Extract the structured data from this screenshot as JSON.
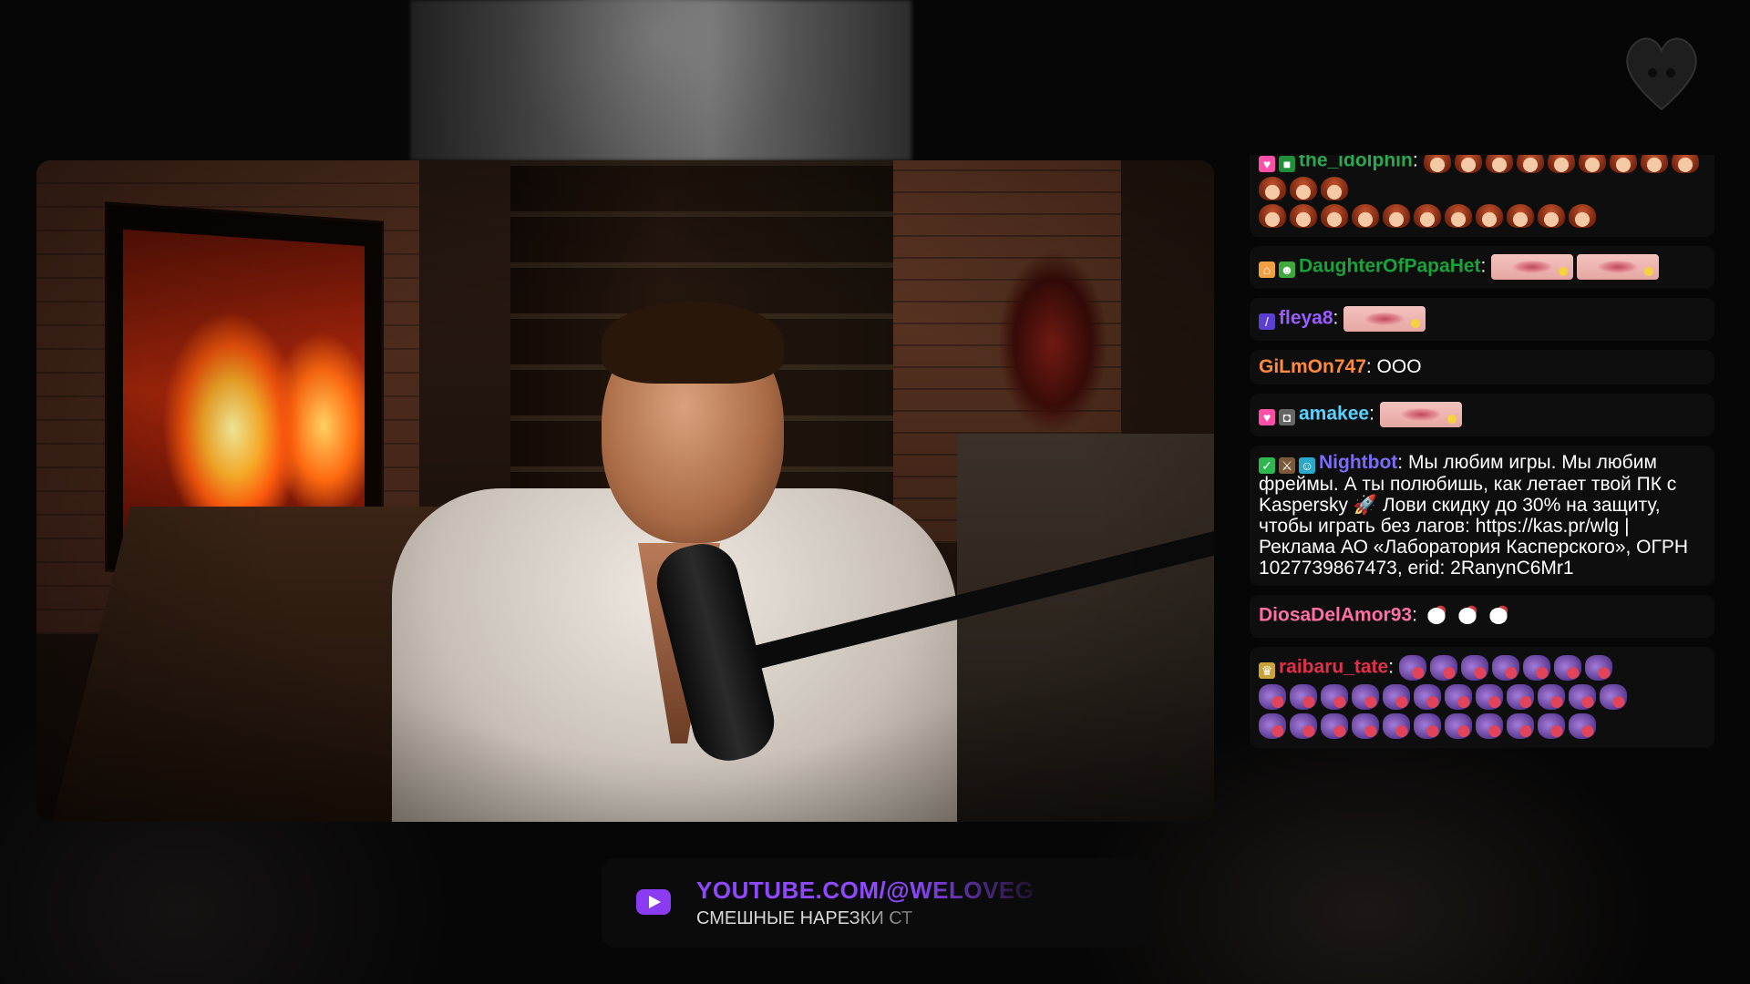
{
  "banner": {
    "icon": "youtube-play-icon",
    "title": "YOUTUBE.COM/@WELOVEG",
    "subtitle": "СМЕШНЫЕ НАРЕЗКИ СТ",
    "accent": "#8f48ff"
  },
  "logo": {
    "icon": "heart-logo-icon"
  },
  "chat": {
    "messages": [
      {
        "user": "the_idolphin",
        "color": "#2ea84f",
        "badges": [
          "heart-badge-icon",
          "bot-badge-icon"
        ],
        "text": "",
        "emote": "girl-emote",
        "emote_rows": [
          12,
          11
        ]
      },
      {
        "user": "DaughterOfPapaHet",
        "color": "#1aa33a",
        "badges": [
          "house-badge-icon",
          "frog-badge-icon"
        ],
        "text": "",
        "emote": "lips-emote",
        "emote_count": 2
      },
      {
        "user": "fleya8",
        "color": "#9b5cff",
        "badges": [
          "rainbow-badge-icon"
        ],
        "text": "",
        "emote": "lips-emote",
        "emote_count": 1
      },
      {
        "user": "GiLmOn747",
        "color": "#ff8a3d",
        "badges": [],
        "text": "ООО"
      },
      {
        "user": "amakee",
        "color": "#5ad1ff",
        "badges": [
          "heart-badge-icon",
          "gamepad-badge-icon"
        ],
        "text": "",
        "emote": "lips-emote",
        "emote_count": 1
      },
      {
        "user": "Nightbot",
        "color": "#7b6cf6",
        "badges": [
          "check-badge-icon",
          "sword-badge-icon",
          "robot-badge-icon"
        ],
        "text": "Мы любим игры. Мы любим фреймы. А ты полюбишь, как летает твой ПК с Kaspersky 🚀 Лови скидку до 30% на защиту, чтобы играть без лагов: https://kas.pr/wlg | Реклама АО «Лаборатория Касперского», ОГРН 1027739867473, erid: 2RanynC6Mr1"
      },
      {
        "user": "DiosaDelAmor93",
        "color": "#ff6fa3",
        "badges": [],
        "text": "",
        "emote": "horse-emote",
        "emote_count": 3
      },
      {
        "user": "raibaru_tate",
        "color": "#e0314b",
        "badges": [
          "trophy-badge-icon"
        ],
        "text": "",
        "emote": "creature-emote",
        "emote_rows": [
          7,
          12,
          11
        ]
      }
    ]
  }
}
